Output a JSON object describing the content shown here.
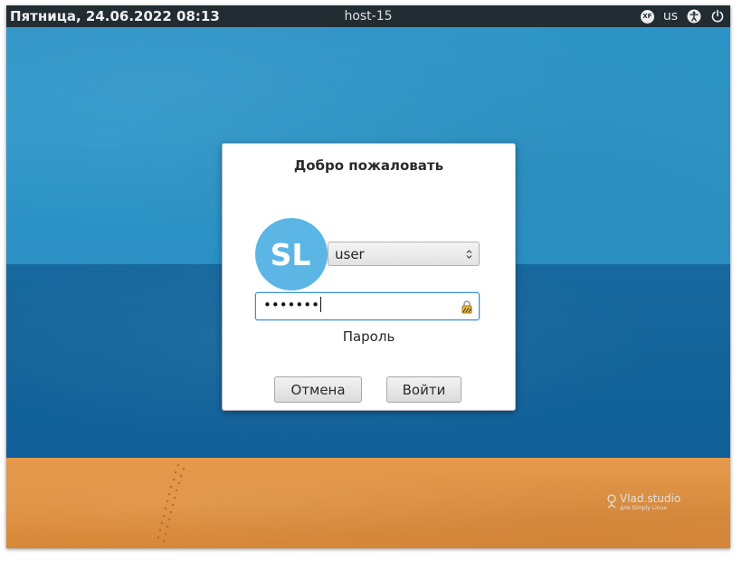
{
  "topbar": {
    "clock": "Пятница, 24.06.2022 08:13",
    "hostname": "host-15",
    "xf_label": "XF",
    "keyboard_layout": "us",
    "icons": [
      "xf-indicator-icon",
      "accessibility-icon",
      "power-icon"
    ]
  },
  "dialog": {
    "title": "Добро пожаловать",
    "avatar_text": "SL",
    "user_select_value": "user",
    "password_value": "•••••••",
    "password_label": "Пароль",
    "cancel_label": "Отмена",
    "login_label": "Войти"
  },
  "watermark": {
    "title": "Vlad.studio",
    "subtitle": "для Simply Linux"
  },
  "colors": {
    "topbar": "#222c33",
    "sky": "#2f97c9",
    "sea": "#13649a",
    "sand": "#e49a4c",
    "avatar": "#5bb6e6",
    "focus": "#3a8fd6"
  }
}
